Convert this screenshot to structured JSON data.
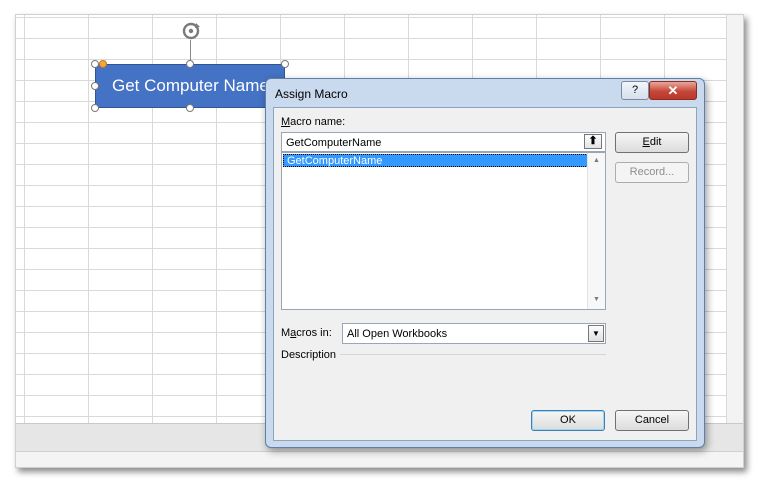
{
  "shape": {
    "label": "Get Computer Name"
  },
  "dialog": {
    "title": "Assign Macro",
    "help_label": "?",
    "close_label": "✕",
    "macro_name_label_prefix": "",
    "macro_name_label_u": "M",
    "macro_name_label_rest": "acro name:",
    "macro_name_value": "GetComputerName",
    "macro_list": [
      "GetComputerName"
    ],
    "macros_in_label_a": "M",
    "macros_in_label_u": "a",
    "macros_in_label_b": "cros in:",
    "macros_in_value": "All Open Workbooks",
    "description_label": "Description",
    "edit_label_u": "E",
    "edit_label_rest": "dit",
    "record_label": "Record...",
    "ok_label": "OK",
    "cancel_label": "Cancel"
  }
}
